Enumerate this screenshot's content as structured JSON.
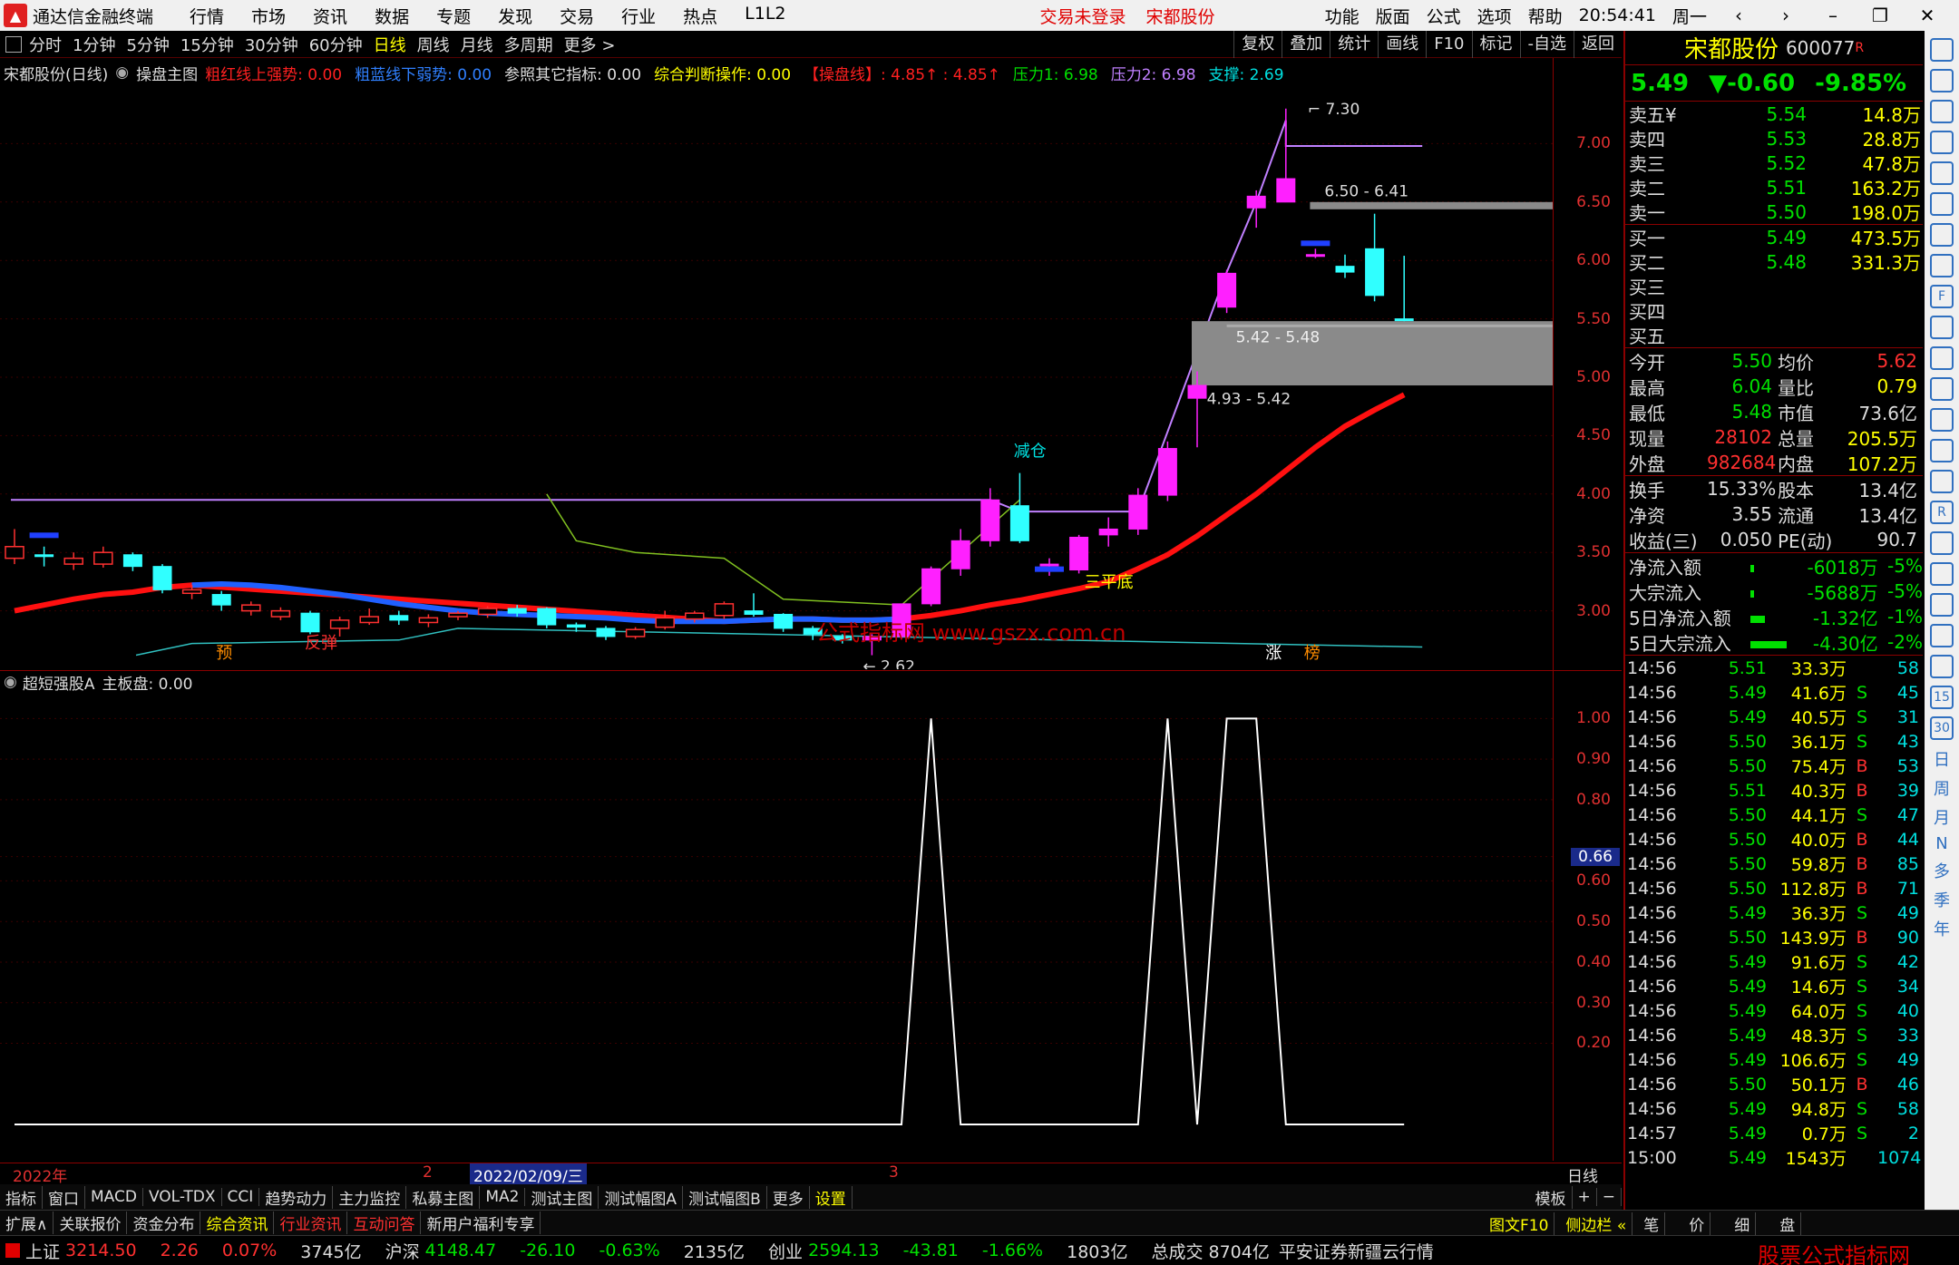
{
  "titlebar": {
    "app_name": "通达信金融终端",
    "menu": [
      "行情",
      "市场",
      "资讯",
      "数据",
      "专题",
      "发现",
      "交易",
      "行业",
      "热点",
      "L1L2"
    ],
    "login_status": "交易未登录",
    "current_stock": "宋都股份",
    "right_menu": [
      "功能",
      "版面",
      "公式",
      "选项",
      "帮助"
    ],
    "clock": "20:54:41",
    "weekday": "周一"
  },
  "toolbar": {
    "periods": [
      "分时",
      "1分钟",
      "5分钟",
      "15分钟",
      "30分钟",
      "60分钟",
      "日线",
      "周线",
      "月线",
      "多周期",
      "更多 >"
    ],
    "active_period": "日线",
    "right_buttons": [
      "复权",
      "叠加",
      "统计",
      "画线",
      "F10",
      "标记",
      "-自选",
      "返回"
    ]
  },
  "indicator_main": {
    "stock": "宋都股份(日线)",
    "name": "操盘主图",
    "items": [
      {
        "text": "粗红线上强势: 0.00",
        "color": "#ff2020"
      },
      {
        "text": "粗蓝线下弱势: 0.00",
        "color": "#3080ff"
      },
      {
        "text": "参照其它指标: 0.00",
        "color": "#dddddd"
      },
      {
        "text": "综合判断操作: 0.00",
        "color": "#ffff00"
      },
      {
        "text": "【操盘线】: 4.85↑ : 4.85↑",
        "color": "#ff2020"
      },
      {
        "text": "压力1: 6.98",
        "color": "#00e000"
      },
      {
        "text": "压力2: 6.98",
        "color": "#c080ff"
      },
      {
        "text": "支撑: 2.69",
        "color": "#00e0e0"
      }
    ]
  },
  "main_yaxis": [
    "7.00",
    "6.50",
    "6.00",
    "5.50",
    "5.00",
    "4.50",
    "4.00",
    "3.50",
    "3.00"
  ],
  "sub_yaxis": [
    "1.00",
    "0.90",
    "0.80",
    "0.66",
    "0.60",
    "0.50",
    "0.40",
    "0.30",
    "0.20"
  ],
  "sub_current": "0.66",
  "indicator_sub": {
    "name": "超短强股A",
    "extra": "主板盘: 0.00"
  },
  "chart_labels": {
    "high": "7.30",
    "low": "2.62",
    "zone1": "6.50 - 6.41",
    "zone2": "5.42 - 5.48",
    "zone3": "4.93 - 5.42",
    "signal_jiben": "减仓",
    "signal_sanping": "三平底",
    "signal_fantan": "反弹",
    "mark_yu": "预",
    "mark_zhang": "涨",
    "mark_bang": "榜",
    "watermark": "公式指标网 www.gszx.com.cn"
  },
  "chart_data": {
    "type": "candlestick",
    "candles": [
      {
        "o": 3.45,
        "c": 3.55,
        "h": 3.7,
        "l": 3.4
      },
      {
        "o": 3.48,
        "c": 3.47,
        "h": 3.55,
        "l": 3.38
      },
      {
        "o": 3.4,
        "c": 3.45,
        "h": 3.5,
        "l": 3.35
      },
      {
        "o": 3.4,
        "c": 3.5,
        "h": 3.55,
        "l": 3.37
      },
      {
        "o": 3.48,
        "c": 3.38,
        "h": 3.5,
        "l": 3.34
      },
      {
        "o": 3.38,
        "c": 3.18,
        "h": 3.4,
        "l": 3.15
      },
      {
        "o": 3.15,
        "c": 3.18,
        "h": 3.22,
        "l": 3.1
      },
      {
        "o": 3.14,
        "c": 3.05,
        "h": 3.17,
        "l": 3.0
      },
      {
        "o": 3.0,
        "c": 3.05,
        "h": 3.08,
        "l": 2.96
      },
      {
        "o": 2.95,
        "c": 3.0,
        "h": 3.03,
        "l": 2.92
      },
      {
        "o": 2.98,
        "c": 2.82,
        "h": 3.0,
        "l": 2.8
      },
      {
        "o": 2.85,
        "c": 2.92,
        "h": 2.95,
        "l": 2.78
      },
      {
        "o": 2.9,
        "c": 2.95,
        "h": 3.02,
        "l": 2.88
      },
      {
        "o": 2.96,
        "c": 2.92,
        "h": 3.0,
        "l": 2.88
      },
      {
        "o": 2.9,
        "c": 2.94,
        "h": 2.97,
        "l": 2.86
      },
      {
        "o": 2.95,
        "c": 2.98,
        "h": 3.0,
        "l": 2.92
      },
      {
        "o": 2.97,
        "c": 3.02,
        "h": 3.04,
        "l": 2.94
      },
      {
        "o": 3.02,
        "c": 2.98,
        "h": 3.05,
        "l": 2.95
      },
      {
        "o": 3.02,
        "c": 2.88,
        "h": 3.03,
        "l": 2.85
      },
      {
        "o": 2.88,
        "c": 2.86,
        "h": 2.9,
        "l": 2.82
      },
      {
        "o": 2.85,
        "c": 2.78,
        "h": 2.87,
        "l": 2.75
      },
      {
        "o": 2.78,
        "c": 2.84,
        "h": 2.86,
        "l": 2.76
      },
      {
        "o": 2.86,
        "c": 2.94,
        "h": 3.0,
        "l": 2.84
      },
      {
        "o": 2.93,
        "c": 2.98,
        "h": 3.0,
        "l": 2.9
      },
      {
        "o": 2.96,
        "c": 3.06,
        "h": 3.08,
        "l": 2.93
      },
      {
        "o": 3.0,
        "c": 2.97,
        "h": 3.15,
        "l": 2.95
      },
      {
        "o": 2.97,
        "c": 2.85,
        "h": 2.98,
        "l": 2.82
      },
      {
        "o": 2.85,
        "c": 2.8,
        "h": 2.87,
        "l": 2.75
      },
      {
        "o": 2.78,
        "c": 2.75,
        "h": 2.8,
        "l": 2.72
      },
      {
        "o": 2.75,
        "c": 2.78,
        "h": 2.8,
        "l": 2.62
      },
      {
        "o": 2.78,
        "c": 3.06,
        "h": 3.06,
        "l": 2.76
      },
      {
        "o": 3.06,
        "c": 3.36,
        "h": 3.38,
        "l": 3.04
      },
      {
        "o": 3.36,
        "c": 3.6,
        "h": 3.7,
        "l": 3.3
      },
      {
        "o": 3.6,
        "c": 3.95,
        "h": 4.05,
        "l": 3.55
      },
      {
        "o": 3.9,
        "c": 3.6,
        "h": 4.18,
        "l": 3.58
      },
      {
        "o": 3.4,
        "c": 3.4,
        "h": 3.45,
        "l": 3.3
      },
      {
        "o": 3.35,
        "c": 3.63,
        "h": 3.65,
        "l": 3.32
      },
      {
        "o": 3.65,
        "c": 3.7,
        "h": 3.8,
        "l": 3.55
      },
      {
        "o": 3.7,
        "c": 3.99,
        "h": 4.05,
        "l": 3.65
      },
      {
        "o": 3.99,
        "c": 4.39,
        "h": 4.45,
        "l": 3.94
      },
      {
        "o": 4.82,
        "c": 4.93,
        "h": 5.05,
        "l": 4.4
      },
      {
        "o": 5.6,
        "c": 5.89,
        "h": 5.92,
        "l": 5.55
      },
      {
        "o": 6.45,
        "c": 6.55,
        "h": 6.6,
        "l": 6.28
      },
      {
        "o": 6.5,
        "c": 6.7,
        "h": 7.3,
        "l": 6.5
      },
      {
        "o": 6.05,
        "c": 6.05,
        "h": 6.1,
        "l": 6.02
      },
      {
        "o": 5.95,
        "c": 5.9,
        "h": 6.05,
        "l": 5.85
      },
      {
        "o": 6.1,
        "c": 5.7,
        "h": 6.4,
        "l": 5.65
      },
      {
        "o": 5.5,
        "c": 5.49,
        "h": 6.04,
        "l": 5.48
      }
    ],
    "ylim": [
      2.5,
      7.5
    ],
    "sub_series": [
      0,
      0,
      0,
      0,
      0,
      0,
      0,
      0,
      0,
      0,
      0,
      0,
      0,
      0,
      0,
      0,
      0,
      0,
      0,
      0,
      0,
      0,
      0,
      0,
      0,
      0,
      0,
      0,
      0,
      0,
      0,
      1,
      0,
      0,
      0,
      0,
      0,
      0,
      0,
      1,
      0,
      1,
      1,
      0,
      0,
      0,
      0,
      0
    ],
    "sub_ylim": [
      0,
      1.05
    ]
  },
  "date_axis": {
    "year": "2022年",
    "m2": "2",
    "date": "2022/02/09/三",
    "m3": "3",
    "period": "日线"
  },
  "bottom_tabs": [
    "指标",
    "窗口",
    "MACD",
    "VOL-TDX",
    "CCI",
    "趋势动力",
    "主力监控",
    "私募主图",
    "MA2",
    "测试主图",
    "测试幅图A",
    "测试幅图B",
    "更多",
    "设置"
  ],
  "bottom_right": [
    "模板",
    "+",
    "−"
  ],
  "tabs2": [
    "扩展∧",
    "关联报价",
    "资金分布",
    "综合资讯",
    "行业资讯",
    "互动问答",
    "新用户福利专享"
  ],
  "tabs2_right": [
    "图文F10",
    "侧边栏 «",
    "笔",
    "价",
    "细",
    "盘"
  ],
  "status": {
    "sh_name": "上证",
    "sh_val": "3214.50",
    "sh_chg": "2.26",
    "sh_pct": "0.07%",
    "sh_amt": "3745亿",
    "hs_name": "沪深",
    "hs_val": "4148.47",
    "hs_chg": "-26.10",
    "hs_pct": "-0.63%",
    "hs_amt": "2135亿",
    "cy_name": "创业",
    "cy_val": "2594.13",
    "cy_chg": "-43.81",
    "cy_pct": "-1.66%",
    "cy_amt": "1803亿",
    "total_label": "总成交",
    "total_val": "8704亿",
    "broker": "平安证券新疆云行情"
  },
  "stock": {
    "name": "宋都股份",
    "code": "600077",
    "tag": "R",
    "price": "5.49",
    "change": "▼-0.60",
    "pct": "-9.85%"
  },
  "order_book": {
    "sell": [
      {
        "label": "卖五¥",
        "price": "5.54",
        "vol": "14.8万"
      },
      {
        "label": "卖四",
        "price": "5.53",
        "vol": "28.8万"
      },
      {
        "label": "卖三",
        "price": "5.52",
        "vol": "47.8万"
      },
      {
        "label": "卖二",
        "price": "5.51",
        "vol": "163.2万"
      },
      {
        "label": "卖一",
        "price": "5.50",
        "vol": "198.0万"
      }
    ],
    "buy": [
      {
        "label": "买一",
        "price": "5.49",
        "vol": "473.5万"
      },
      {
        "label": "买二",
        "price": "5.48",
        "vol": "331.3万"
      },
      {
        "label": "买三",
        "price": "",
        "vol": ""
      },
      {
        "label": "买四",
        "price": "",
        "vol": ""
      },
      {
        "label": "买五",
        "price": "",
        "vol": ""
      }
    ]
  },
  "stats": [
    {
      "a": "今开",
      "b": "5.50",
      "bc": "#00e000",
      "c": "均价",
      "d": "5.62",
      "dc": "#ff3030"
    },
    {
      "a": "最高",
      "b": "6.04",
      "bc": "#00e000",
      "c": "量比",
      "d": "0.79",
      "dc": "#ffff00"
    },
    {
      "a": "最低",
      "b": "5.48",
      "bc": "#00e000",
      "c": "市值",
      "d": "73.6亿",
      "dc": "#dddddd"
    },
    {
      "a": "现量",
      "b": "28102",
      "bc": "#ff3030",
      "c": "总量",
      "d": "205.5万",
      "dc": "#ffff00"
    },
    {
      "a": "外盘",
      "b": "982684",
      "bc": "#ff3030",
      "c": "内盘",
      "d": "107.2万",
      "dc": "#ffff00"
    }
  ],
  "stats2": [
    {
      "a": "换手",
      "b": "15.33%",
      "bc": "#dddddd",
      "c": "股本",
      "d": "13.4亿",
      "dc": "#dddddd"
    },
    {
      "a": "净资",
      "b": "3.55",
      "bc": "#dddddd",
      "c": "流通",
      "d": "13.4亿",
      "dc": "#dddddd"
    },
    {
      "a": "收益(三)",
      "b": "0.050",
      "bc": "#dddddd",
      "c": "PE(动)",
      "d": "90.7",
      "dc": "#dddddd"
    }
  ],
  "flows": [
    {
      "label": "净流入额",
      "bar": 2,
      "val": "-6018万",
      "pct": "-5%"
    },
    {
      "label": "大宗流入",
      "bar": 2,
      "val": "-5688万",
      "pct": "-5%"
    },
    {
      "label": "5日净流入额",
      "bar": 8,
      "val": "-1.32亿",
      "pct": "-1%"
    },
    {
      "label": "5日大宗流入",
      "bar": 20,
      "val": "-4.30亿",
      "pct": "-2%"
    }
  ],
  "ticks": [
    {
      "t": "14:56",
      "p": "5.51",
      "pc": "#00e000",
      "v": "33.3万",
      "s": "",
      "n": "58"
    },
    {
      "t": "14:56",
      "p": "5.49",
      "pc": "#00e000",
      "v": "41.6万",
      "s": "S",
      "n": "45"
    },
    {
      "t": "14:56",
      "p": "5.49",
      "pc": "#00e000",
      "v": "40.5万",
      "s": "S",
      "n": "31"
    },
    {
      "t": "14:56",
      "p": "5.50",
      "pc": "#00e000",
      "v": "36.1万",
      "s": "S",
      "n": "43"
    },
    {
      "t": "14:56",
      "p": "5.50",
      "pc": "#00e000",
      "v": "75.4万",
      "s": "B",
      "n": "53"
    },
    {
      "t": "14:56",
      "p": "5.51",
      "pc": "#00e000",
      "v": "40.3万",
      "s": "B",
      "n": "39"
    },
    {
      "t": "14:56",
      "p": "5.50",
      "pc": "#00e000",
      "v": "44.1万",
      "s": "S",
      "n": "47"
    },
    {
      "t": "14:56",
      "p": "5.50",
      "pc": "#00e000",
      "v": "40.0万",
      "s": "B",
      "n": "44"
    },
    {
      "t": "14:56",
      "p": "5.50",
      "pc": "#00e000",
      "v": "59.8万",
      "s": "B",
      "n": "85"
    },
    {
      "t": "14:56",
      "p": "5.50",
      "pc": "#00e000",
      "v": "112.8万",
      "s": "B",
      "n": "71"
    },
    {
      "t": "14:56",
      "p": "5.49",
      "pc": "#00e000",
      "v": "36.3万",
      "s": "S",
      "n": "49"
    },
    {
      "t": "14:56",
      "p": "5.50",
      "pc": "#00e000",
      "v": "143.9万",
      "s": "B",
      "n": "90"
    },
    {
      "t": "14:56",
      "p": "5.49",
      "pc": "#00e000",
      "v": "91.6万",
      "s": "S",
      "n": "42"
    },
    {
      "t": "14:56",
      "p": "5.49",
      "pc": "#00e000",
      "v": "14.6万",
      "s": "S",
      "n": "34"
    },
    {
      "t": "14:56",
      "p": "5.49",
      "pc": "#00e000",
      "v": "64.0万",
      "s": "S",
      "n": "40"
    },
    {
      "t": "14:56",
      "p": "5.49",
      "pc": "#00e000",
      "v": "48.3万",
      "s": "S",
      "n": "33"
    },
    {
      "t": "14:56",
      "p": "5.49",
      "pc": "#00e000",
      "v": "106.6万",
      "s": "S",
      "n": "49"
    },
    {
      "t": "14:56",
      "p": "5.50",
      "pc": "#00e000",
      "v": "50.1万",
      "s": "B",
      "n": "46"
    },
    {
      "t": "14:56",
      "p": "5.49",
      "pc": "#00e000",
      "v": "94.8万",
      "s": "S",
      "n": "58"
    },
    {
      "t": "14:57",
      "p": "5.49",
      "pc": "#00e000",
      "v": "0.7万",
      "s": "S",
      "n": "2"
    },
    {
      "t": "15:00",
      "p": "5.49",
      "pc": "#00e000",
      "v": "1543万",
      "s": "",
      "n": "1074"
    }
  ],
  "side_vertical": [
    "日",
    "周",
    "月",
    "N",
    "多",
    "季",
    "年"
  ],
  "footer_watermark": "股票公式指标网",
  "footer_url": "www.gszx.com.cn"
}
